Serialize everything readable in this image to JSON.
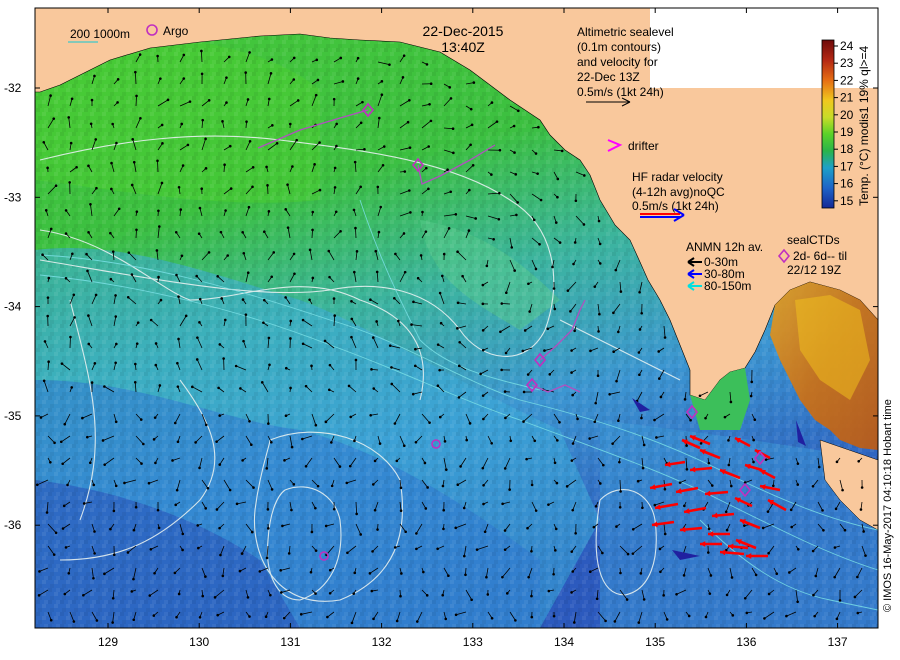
{
  "header": {
    "date": "22-Dec-2015",
    "time": "13:40Z"
  },
  "legend_top_left": {
    "depth_contours": "200  1000m",
    "argo": "Argo"
  },
  "altimetry_legend": {
    "lines": [
      "Altimetric sealevel",
      "(0.1m contours)",
      "and velocity for",
      "22-Dec 13Z",
      "0.5m/s (1kt 24h)"
    ]
  },
  "drifter_legend": "drifter",
  "hf_radar_legend": {
    "lines": [
      "HF radar velocity",
      "(4-12h avg)noQC",
      "0.5m/s (1kt 24h)"
    ]
  },
  "anmn_legend": {
    "title": "ANMN 12h av.",
    "items": [
      {
        "label": "0-30m",
        "color": "#000000"
      },
      {
        "label": "30-80m",
        "color": "#0000ff"
      },
      {
        "label": "80-150m",
        "color": "#00e0e0"
      }
    ]
  },
  "seal_legend": {
    "lines": [
      "sealCTDs",
      "2d- 6d-- til",
      "22/12 19Z"
    ]
  },
  "colorbar": {
    "title": "Temp. (°C) modis1 19% ql>=4",
    "ticks": [
      "24",
      "23",
      "22",
      "21",
      "20",
      "19",
      "18",
      "17",
      "16",
      "15"
    ],
    "colors": [
      "#6e0a0a",
      "#b42814",
      "#e66e14",
      "#f0b41e",
      "#c8dc28",
      "#5ad228",
      "#2ab44a",
      "#1ea0c8",
      "#1e64c8",
      "#142896"
    ]
  },
  "axes": {
    "x_ticks": [
      "129",
      "130",
      "131",
      "132",
      "133",
      "134",
      "135",
      "136",
      "137"
    ],
    "y_ticks": [
      "-32",
      "-33",
      "-34",
      "-35",
      "-36"
    ]
  },
  "credit": "© IMOS 16-May-2017 04:10:18 Hobart time",
  "colors": {
    "land": "#f9c89c",
    "ocean_green": "#3cc83c",
    "ocean_blue": "#3c8cdc",
    "hf_radar": "#ff0000",
    "argo": "#c030c0"
  }
}
